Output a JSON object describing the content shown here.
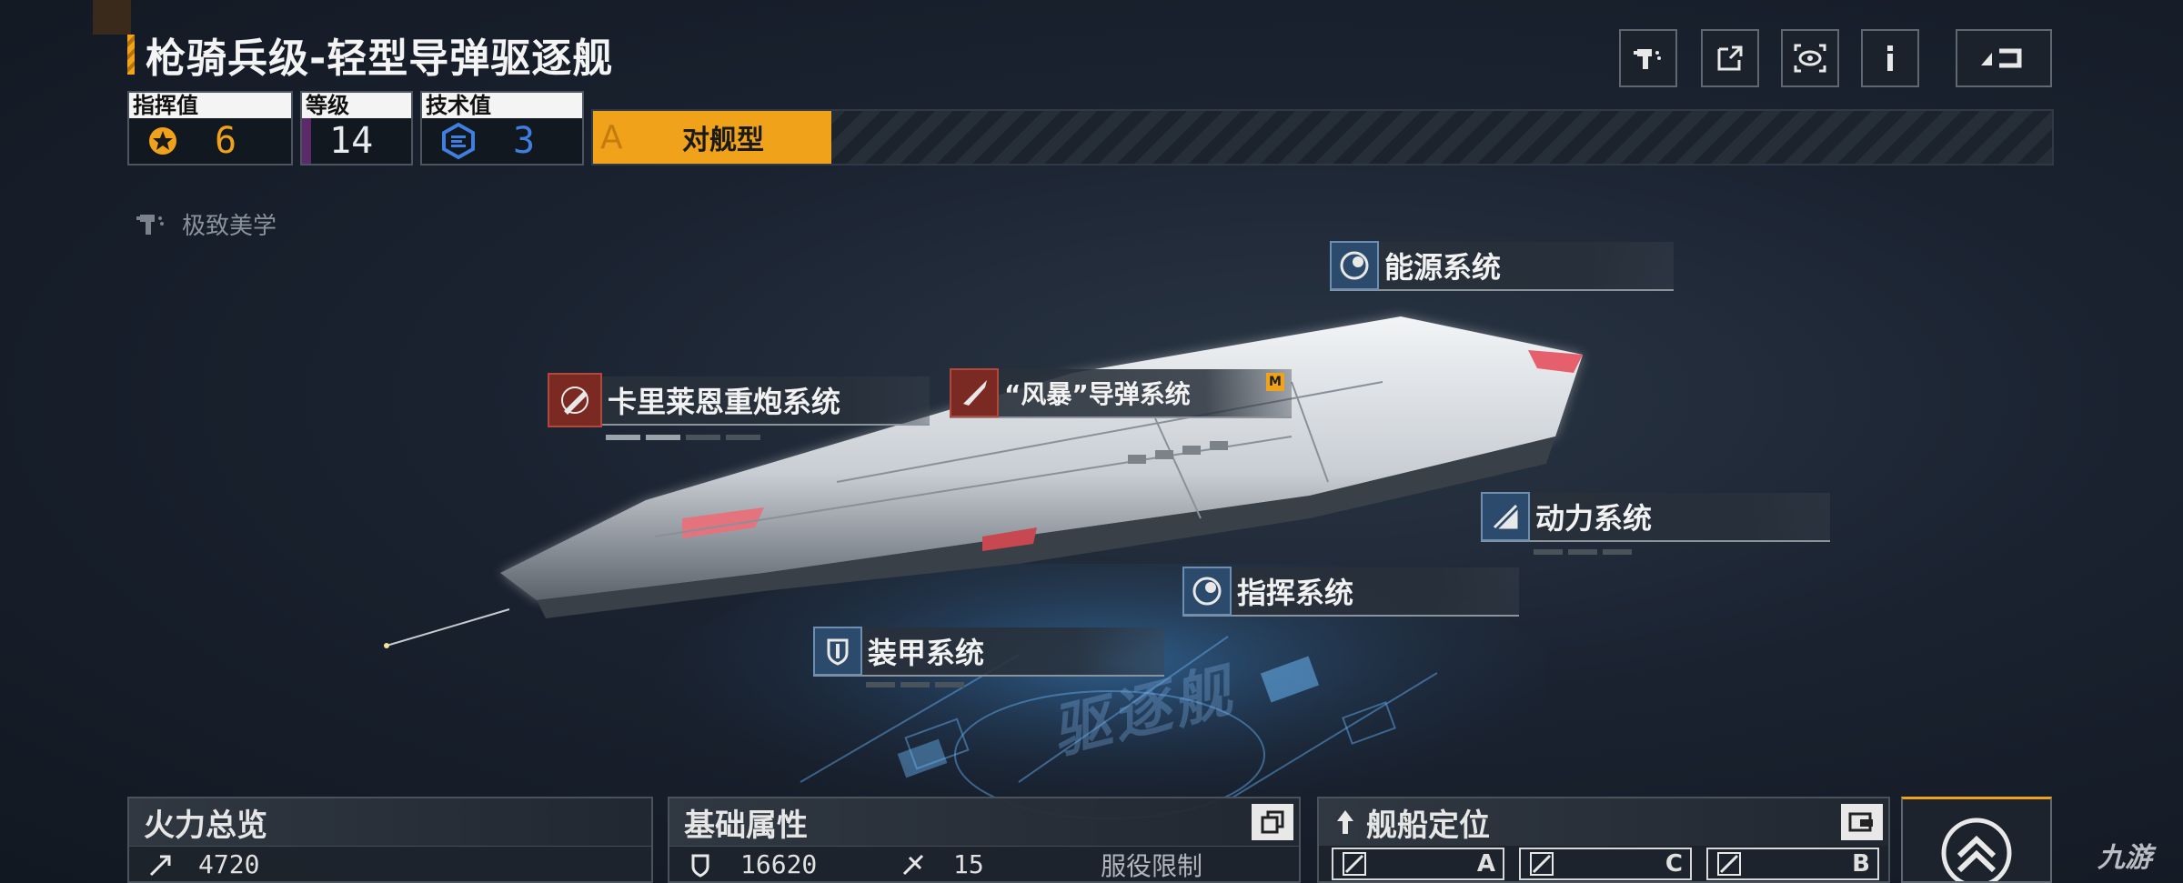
{
  "header": {
    "title": "枪骑兵级-轻型导弹驱逐舰",
    "buttons": [
      "paint-icon",
      "external-link-icon",
      "view-icon",
      "info-icon",
      "back-icon"
    ]
  },
  "stats": {
    "command": {
      "label": "指挥值",
      "value": "6",
      "color": "#f0a21a"
    },
    "level": {
      "label": "等级",
      "value": "14",
      "color": "#f0f0f0"
    },
    "tech": {
      "label": "技术值",
      "value": "3",
      "color": "#3f7fe0"
    }
  },
  "ship_type": {
    "letter": "A",
    "label": "对舰型"
  },
  "aesthetic": {
    "label": "极致美学"
  },
  "systems": {
    "energy": "能源系统",
    "cannon": "卡里莱恩重炮系统",
    "missile": "“风暴”导弹系统",
    "missile_badge": "M",
    "power": "动力系统",
    "command": "指挥系统",
    "armor": "装甲系统"
  },
  "floor_word": "驱逐舰",
  "panels": {
    "firepower": {
      "title": "火力总览",
      "value": "4720"
    },
    "attributes": {
      "title": "基础属性",
      "armor_value": "16620",
      "speed_value": "15",
      "service_limit": "服役限制"
    },
    "positioning": {
      "title": "舰船定位",
      "roles": [
        "A",
        "C",
        "B"
      ]
    }
  },
  "watermark": "九游"
}
